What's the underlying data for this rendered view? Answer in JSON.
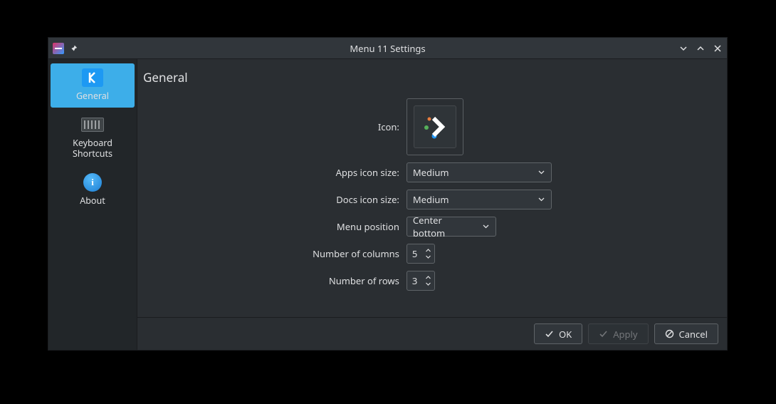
{
  "window_title": "Menu 11 Settings",
  "sidebar": {
    "items": [
      {
        "label": "General",
        "icon": "kde-badge",
        "selected": true
      },
      {
        "label": "Keyboard\nShortcuts",
        "icon": "keyboard-icon",
        "selected": false
      },
      {
        "label": "About",
        "icon": "about-icon",
        "selected": false
      }
    ]
  },
  "page": {
    "heading": "General",
    "fields": {
      "icon_label": "Icon:",
      "apps_icon_size_label": "Apps icon size:",
      "apps_icon_size_value": "Medium",
      "docs_icon_size_label": "Docs icon size:",
      "docs_icon_size_value": "Medium",
      "menu_position_label": "Menu position",
      "menu_position_value": "Center bottom",
      "columns_label": "Number of columns",
      "columns_value": "5",
      "rows_label": "Number of rows",
      "rows_value": "3"
    }
  },
  "footer": {
    "ok": "OK",
    "apply": "Apply",
    "cancel": "Cancel",
    "apply_enabled": false
  }
}
